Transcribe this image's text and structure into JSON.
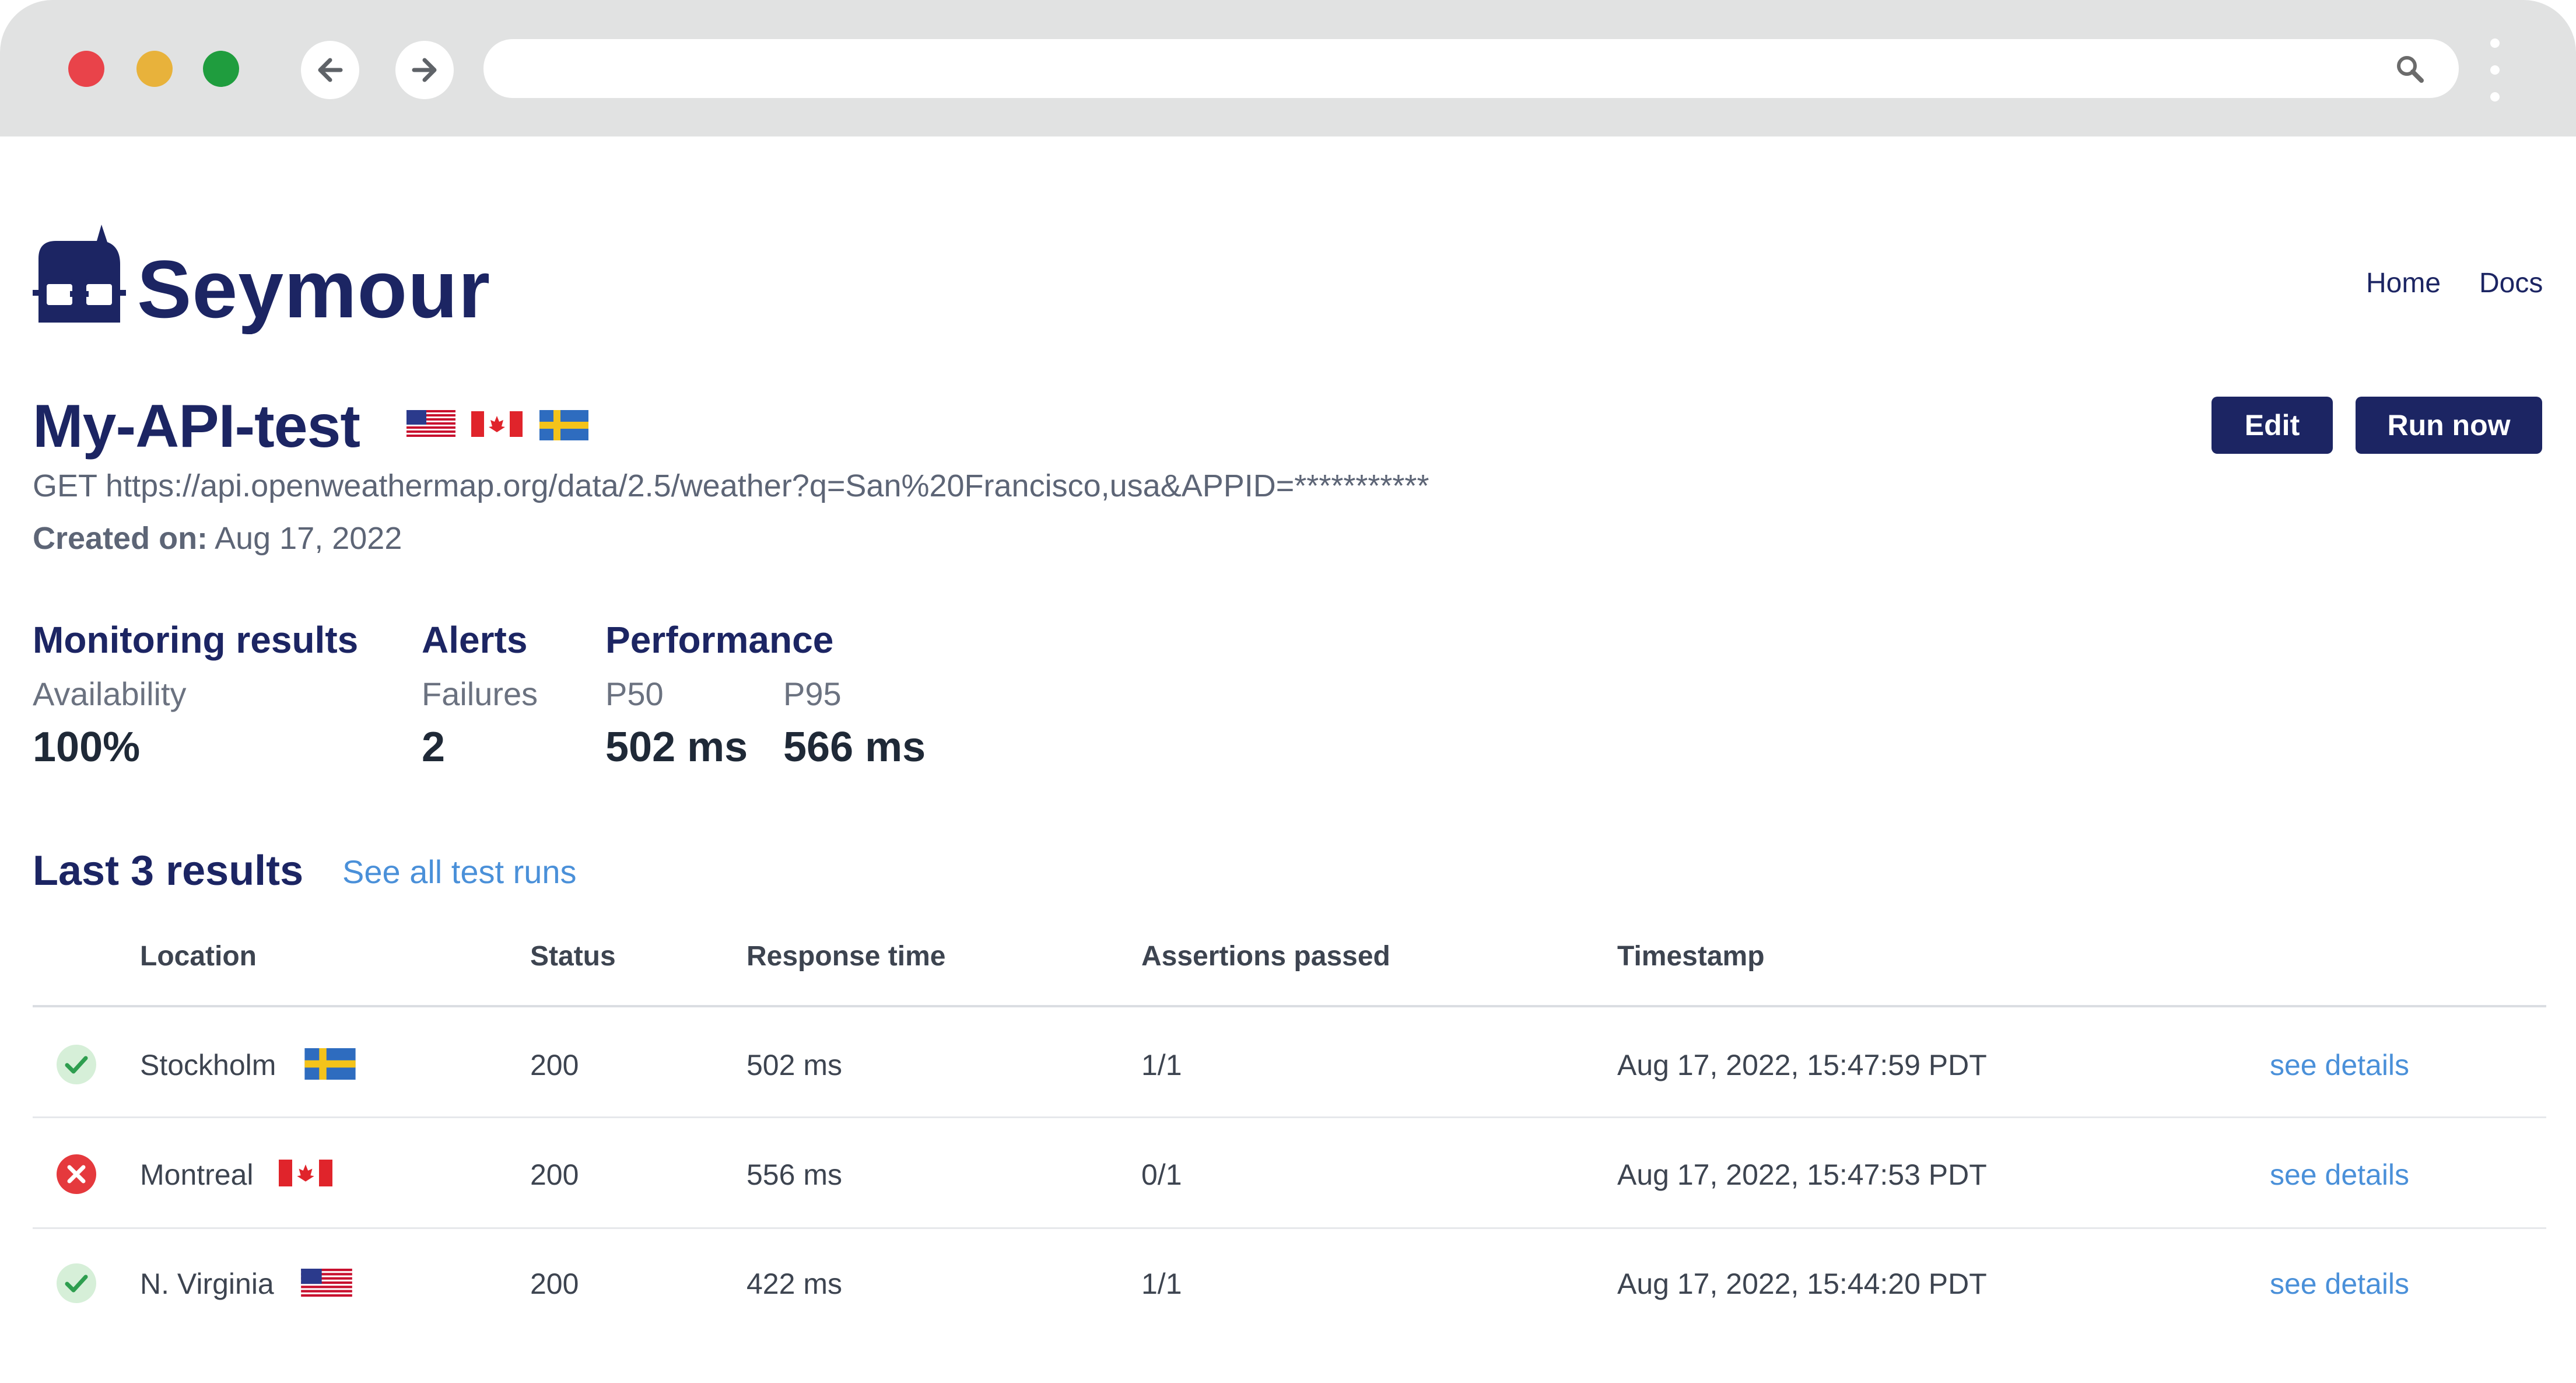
{
  "browser": {
    "url": "",
    "colors": {
      "close": "#e9434a",
      "minimize": "#e8b23b",
      "maximize": "#1f9d3e"
    }
  },
  "brand": {
    "name": "Seymour",
    "color": "#1c2563"
  },
  "nav": {
    "home": "Home",
    "docs": "Docs"
  },
  "test": {
    "name": "My-API-test",
    "flags": [
      "us-flag",
      "ca-flag",
      "se-flag"
    ],
    "request": "GET https://api.openweathermap.org/data/2.5/weather?q=San%20Francisco,usa&APPID=***********",
    "created_label": "Created on:",
    "created_value": "Aug 17, 2022"
  },
  "actions": {
    "edit": "Edit",
    "run_now": "Run now"
  },
  "metrics": {
    "monitoring": {
      "heading": "Monitoring results",
      "label": "Availability",
      "value": "100%"
    },
    "alerts": {
      "heading": "Alerts",
      "label": "Failures",
      "value": "2"
    },
    "performance": {
      "heading": "Performance",
      "p50_label": "P50",
      "p50_value": "502 ms",
      "p95_label": "P95",
      "p95_value": "566 ms"
    }
  },
  "results": {
    "title": "Last 3 results",
    "see_all": "See all test runs",
    "columns": [
      "Location",
      "Status",
      "Response time",
      "Assertions passed",
      "Timestamp"
    ],
    "rows": [
      {
        "result": "pass",
        "location": "Stockholm",
        "flag": "se-flag",
        "status": "200",
        "response_time": "502 ms",
        "assertions": "1/1",
        "timestamp": "Aug 17, 2022, 15:47:59 PDT",
        "details": "see details"
      },
      {
        "result": "fail",
        "location": "Montreal",
        "flag": "ca-flag",
        "status": "200",
        "response_time": "556 ms",
        "assertions": "0/1",
        "timestamp": "Aug 17, 2022, 15:47:53 PDT",
        "details": "see details"
      },
      {
        "result": "pass",
        "location": "N. Virginia",
        "flag": "us-flag",
        "status": "200",
        "response_time": "422 ms",
        "assertions": "1/1",
        "timestamp": "Aug 17, 2022, 15:44:20 PDT",
        "details": "see details"
      }
    ]
  }
}
